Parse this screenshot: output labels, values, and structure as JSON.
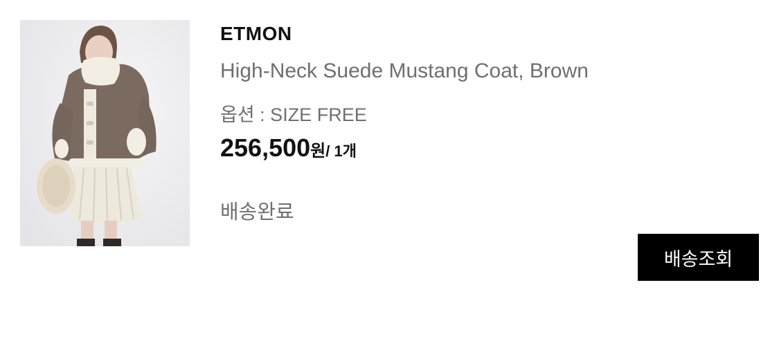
{
  "order_item": {
    "brand": "ETMON",
    "product_name": "High-Neck Suede Mustang Coat, Brown",
    "option_text": "옵션 : SIZE FREE",
    "price_amount": "256,500",
    "price_unit": "원",
    "quantity_text": "/ 1개",
    "status": "배송완료",
    "track_button_label": "배송조회",
    "image": {
      "subject": "model wearing brown suede shearling coat with white fleece collar, white pleated skirt and fluffy bag",
      "colors": {
        "background": "#ececee",
        "coat": "#7b6a5f",
        "shearling": "#f3eee4",
        "skirt": "#eee9dd"
      }
    }
  }
}
